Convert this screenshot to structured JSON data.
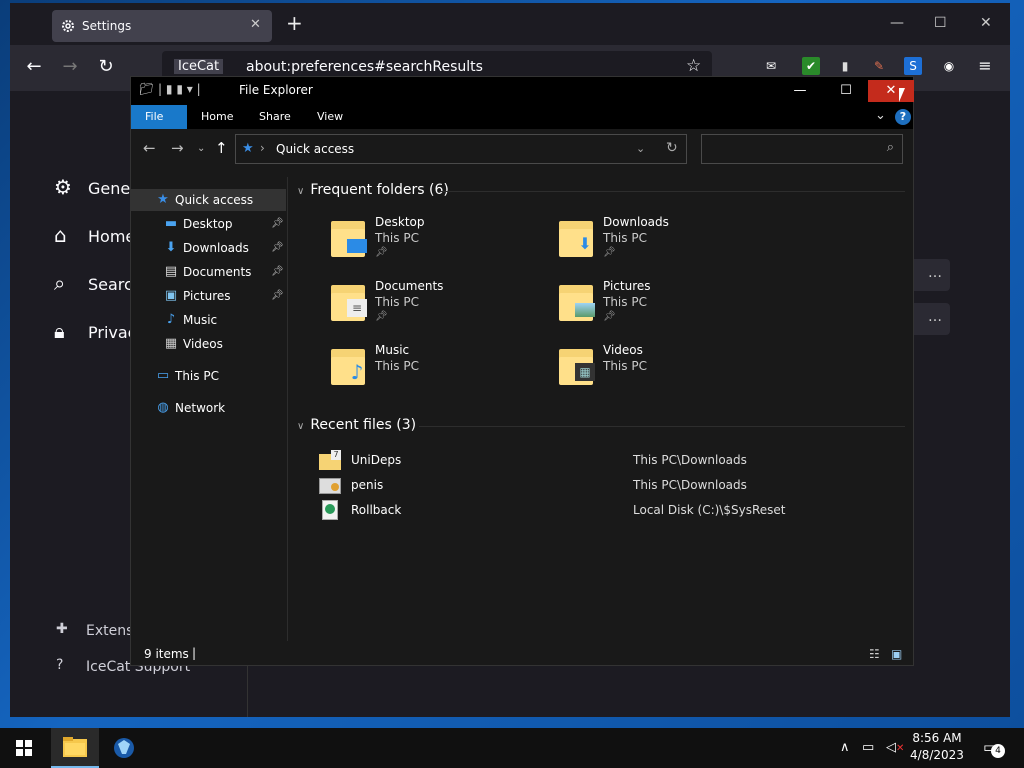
{
  "browser": {
    "tab_title": "Settings",
    "site_label": "IceCat",
    "url": "about:preferences#searchResults",
    "sidebar": [
      {
        "label": "General"
      },
      {
        "label": "Home"
      },
      {
        "label": "Search"
      },
      {
        "label": "Privacy"
      }
    ],
    "footer": [
      {
        "label": "Extensions"
      },
      {
        "label": "IceCat Support"
      }
    ]
  },
  "explorer": {
    "title": "File Explorer",
    "ribbon_tabs": [
      "File",
      "Home",
      "Share",
      "View"
    ],
    "address": "Quick access",
    "nav": [
      {
        "label": "Quick access",
        "icon": "star-icon"
      },
      {
        "label": "Desktop",
        "icon": "desktop-icon"
      },
      {
        "label": "Downloads",
        "icon": "download-icon"
      },
      {
        "label": "Documents",
        "icon": "documents-icon"
      },
      {
        "label": "Pictures",
        "icon": "pictures-icon"
      },
      {
        "label": "Music",
        "icon": "music-icon"
      },
      {
        "label": "Videos",
        "icon": "videos-icon"
      },
      {
        "label": "This PC",
        "icon": "computer-icon"
      },
      {
        "label": "Network",
        "icon": "network-icon"
      }
    ],
    "frequent_header": "Frequent folders (6)",
    "frequent": [
      {
        "name": "Desktop",
        "location": "This PC",
        "pinned": true,
        "badge": "desktop"
      },
      {
        "name": "Downloads",
        "location": "This PC",
        "pinned": true,
        "badge": "download"
      },
      {
        "name": "Documents",
        "location": "This PC",
        "pinned": true,
        "badge": "documents"
      },
      {
        "name": "Pictures",
        "location": "This PC",
        "pinned": true,
        "badge": "pictures"
      },
      {
        "name": "Music",
        "location": "This PC",
        "pinned": false,
        "badge": "music"
      },
      {
        "name": "Videos",
        "location": "This PC",
        "pinned": false,
        "badge": "videos"
      }
    ],
    "recent_header": "Recent files (3)",
    "recent": [
      {
        "name": "UniDeps",
        "path": "This PC\\Downloads"
      },
      {
        "name": "penis",
        "path": "This PC\\Downloads"
      },
      {
        "name": "Rollback",
        "path": "Local Disk (C:)\\$SysReset"
      }
    ],
    "status": "9 items"
  },
  "taskbar": {
    "time": "8:56 AM",
    "date": "4/8/2023",
    "notification_count": "4"
  }
}
